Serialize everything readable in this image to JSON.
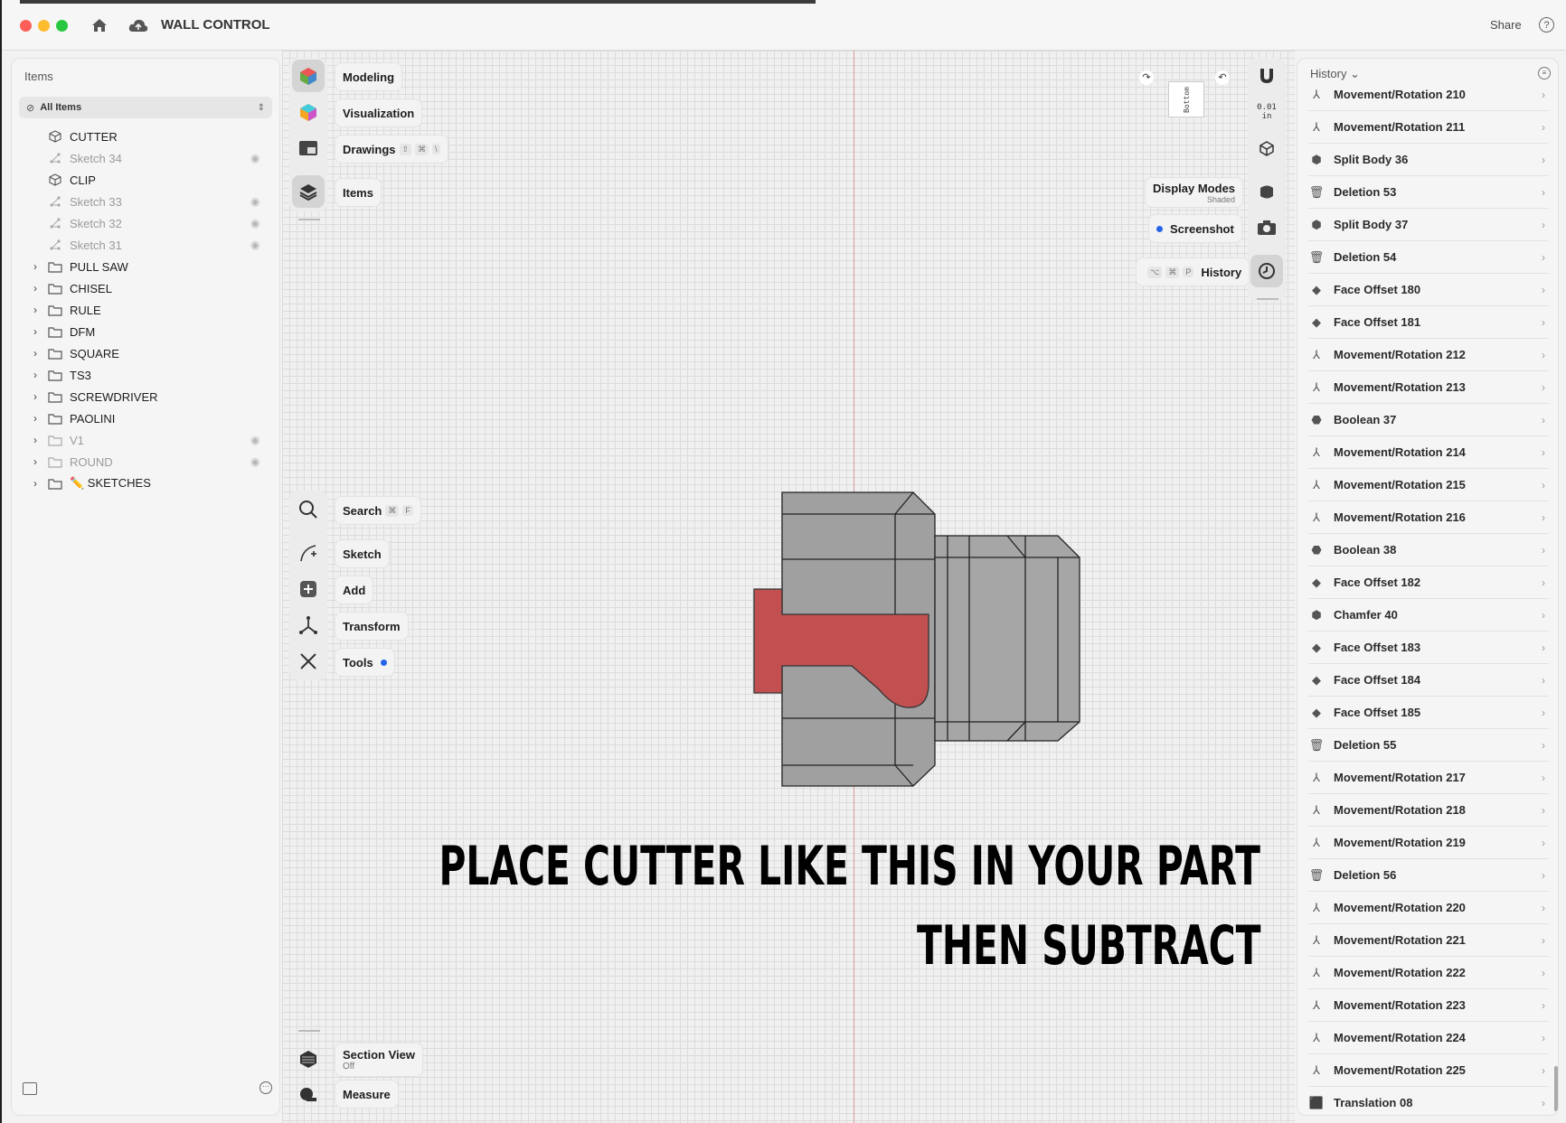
{
  "window": {
    "title": "WALL CONTROL",
    "share_label": "Share",
    "help_label": "?"
  },
  "items_panel": {
    "title": "Items",
    "filter_label": "All Items",
    "rows": [
      {
        "label": "CUTTER",
        "type": "body",
        "dim": false,
        "expand": false,
        "eye": false
      },
      {
        "label": "Sketch 34",
        "type": "sketch",
        "dim": true,
        "expand": false,
        "eye": true
      },
      {
        "label": "CLIP",
        "type": "body",
        "dim": false,
        "expand": false,
        "eye": false
      },
      {
        "label": "Sketch 33",
        "type": "sketch",
        "dim": true,
        "expand": false,
        "eye": true
      },
      {
        "label": "Sketch 32",
        "type": "sketch",
        "dim": true,
        "expand": false,
        "eye": true
      },
      {
        "label": "Sketch 31",
        "type": "sketch",
        "dim": true,
        "expand": false,
        "eye": true
      },
      {
        "label": "PULL SAW",
        "type": "folder",
        "dim": false,
        "expand": true,
        "eye": false
      },
      {
        "label": "CHISEL",
        "type": "folder",
        "dim": false,
        "expand": true,
        "eye": false
      },
      {
        "label": "RULE",
        "type": "folder",
        "dim": false,
        "expand": true,
        "eye": false
      },
      {
        "label": "DFM",
        "type": "folder",
        "dim": false,
        "expand": true,
        "eye": false
      },
      {
        "label": "SQUARE",
        "type": "folder",
        "dim": false,
        "expand": true,
        "eye": false
      },
      {
        "label": "TS3",
        "type": "folder",
        "dim": false,
        "expand": true,
        "eye": false
      },
      {
        "label": "SCREWDRIVER",
        "type": "folder",
        "dim": false,
        "expand": true,
        "eye": false
      },
      {
        "label": "PAOLINI",
        "type": "folder",
        "dim": false,
        "expand": true,
        "eye": false
      },
      {
        "label": "V1",
        "type": "folder",
        "dim": true,
        "expand": true,
        "eye": true
      },
      {
        "label": "ROUND",
        "type": "folder",
        "dim": true,
        "expand": true,
        "eye": true
      },
      {
        "label": "✏️ SKETCHES",
        "type": "folder",
        "dim": false,
        "expand": true,
        "eye": false
      }
    ]
  },
  "top_tools": {
    "modeling": "Modeling",
    "visualization": "Visualization",
    "drawings": "Drawings",
    "drawings_keys": [
      "⇧",
      "⌘",
      "\\"
    ],
    "items": "Items"
  },
  "bottom_tools": {
    "search": "Search",
    "search_keys": [
      "⌘",
      "F"
    ],
    "sketch": "Sketch",
    "add": "Add",
    "transform": "Transform",
    "tools": "Tools",
    "section_view": "Section View",
    "section_view_state": "Off",
    "measure": "Measure"
  },
  "right_tools": {
    "view_cube_label": "Bottom",
    "snap_value": "0.01",
    "snap_unit": "in",
    "display_modes": "Display Modes",
    "display_modes_state": "Shaded",
    "screenshot": "Screenshot",
    "history": "History",
    "history_keys": [
      "⌥",
      "⌘",
      "P"
    ]
  },
  "annotation": {
    "line1": "PLACE CUTTER LIKE THIS IN YOUR PART",
    "line2": "THEN SUBTRACT"
  },
  "history_panel": {
    "title": "History ⌄",
    "rows": [
      {
        "label": "Movement/Rotation 210",
        "icon": "move"
      },
      {
        "label": "Movement/Rotation 211",
        "icon": "move"
      },
      {
        "label": "Split Body 36",
        "icon": "split"
      },
      {
        "label": "Deletion 53",
        "icon": "delete"
      },
      {
        "label": "Split Body 37",
        "icon": "split"
      },
      {
        "label": "Deletion 54",
        "icon": "delete"
      },
      {
        "label": "Face Offset 180",
        "icon": "face"
      },
      {
        "label": "Face Offset 181",
        "icon": "face"
      },
      {
        "label": "Movement/Rotation 212",
        "icon": "move"
      },
      {
        "label": "Movement/Rotation 213",
        "icon": "move"
      },
      {
        "label": "Boolean 37",
        "icon": "boolean"
      },
      {
        "label": "Movement/Rotation 214",
        "icon": "move"
      },
      {
        "label": "Movement/Rotation 215",
        "icon": "move"
      },
      {
        "label": "Movement/Rotation 216",
        "icon": "move"
      },
      {
        "label": "Boolean 38",
        "icon": "boolean"
      },
      {
        "label": "Face Offset 182",
        "icon": "face"
      },
      {
        "label": "Chamfer 40",
        "icon": "chamfer"
      },
      {
        "label": "Face Offset 183",
        "icon": "face"
      },
      {
        "label": "Face Offset 184",
        "icon": "face"
      },
      {
        "label": "Face Offset 185",
        "icon": "face"
      },
      {
        "label": "Deletion 55",
        "icon": "delete"
      },
      {
        "label": "Movement/Rotation 217",
        "icon": "move"
      },
      {
        "label": "Movement/Rotation 218",
        "icon": "move"
      },
      {
        "label": "Movement/Rotation 219",
        "icon": "move"
      },
      {
        "label": "Deletion 56",
        "icon": "delete"
      },
      {
        "label": "Movement/Rotation 220",
        "icon": "move"
      },
      {
        "label": "Movement/Rotation 221",
        "icon": "move"
      },
      {
        "label": "Movement/Rotation 222",
        "icon": "move"
      },
      {
        "label": "Movement/Rotation 223",
        "icon": "move"
      },
      {
        "label": "Movement/Rotation 224",
        "icon": "move"
      },
      {
        "label": "Movement/Rotation 225",
        "icon": "move"
      },
      {
        "label": "Translation 08",
        "icon": "translate"
      }
    ]
  },
  "colors": {
    "accent": "#2563eb",
    "cutter": "#c25050",
    "part": "#9b9b9b",
    "close": "#ff5f57",
    "minimize": "#febc2e",
    "zoom": "#28c840"
  }
}
